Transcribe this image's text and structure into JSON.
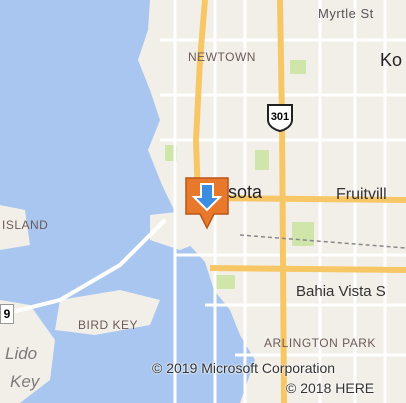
{
  "map": {
    "labels": {
      "myrtle_st": "Myrtle St",
      "newtown": "NEWTOWN",
      "ko": "Ko",
      "sarasota": "sota",
      "fruitville": "Fruitvill",
      "island": "ISLAND",
      "bahia_vista": "Bahia Vista S",
      "bird_key": "BIRD KEY",
      "arlington_park": "ARLINGTON PARK",
      "lido": "Lido",
      "key": "Key",
      "nine": "9"
    },
    "highway_shield": {
      "number": "301",
      "icon": "us-highway-shield-icon"
    },
    "pin": {
      "icon": "location-pin-icon",
      "color": "#e8782a",
      "arrow_color": "#3c8de0"
    },
    "colors": {
      "water": "#a8c6ef",
      "land": "#f2efe9",
      "major_road": "#f7c766",
      "minor_road": "#ffffff",
      "park": "#cfe5a9"
    },
    "copyright": {
      "microsoft": "© 2019 Microsoft Corporation",
      "here": "© 2018 HERE"
    }
  }
}
